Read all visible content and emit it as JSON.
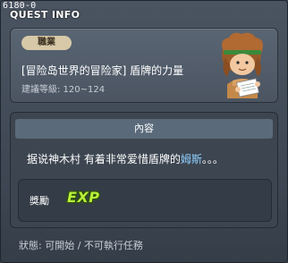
{
  "window": {
    "quest_id": "6180-0",
    "title": "QUEST INFO"
  },
  "info": {
    "job_badge": "職業",
    "quest_name": "[冒险岛世界的冒险家] 盾牌的力量",
    "level_text": "建議等級: 120~124",
    "npc_icon": "npc-portrait-icon"
  },
  "content": {
    "header": "內容",
    "text_before": "据说神木村 有着非常爱惜盾牌的",
    "highlight_name": "姆斯",
    "text_after": "。。。",
    "highlight_color": "#8fd0ff"
  },
  "reward": {
    "label": "獎勵",
    "exp_label": "EXP"
  },
  "status": {
    "text": "狀態: 可開始 / 不可執行任務"
  }
}
